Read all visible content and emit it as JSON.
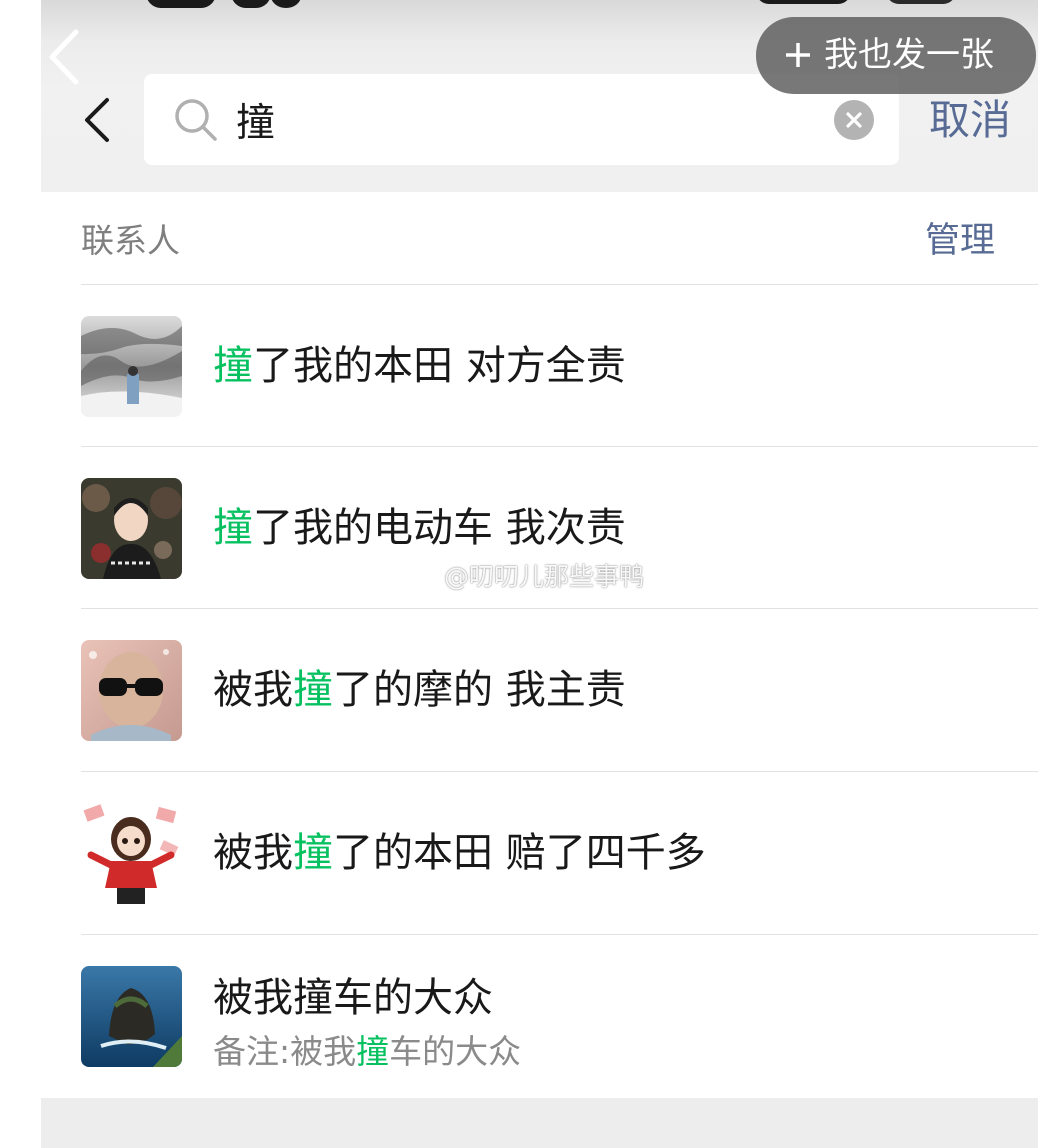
{
  "header": {
    "search_query": "撞",
    "cancel_label": "取消",
    "post_button_label": "我也发一张"
  },
  "section": {
    "title": "联系人",
    "manage_label": "管理"
  },
  "contacts": [
    {
      "pre": "",
      "hl": "撞",
      "post": "了我的本田 对方全责"
    },
    {
      "pre": "",
      "hl": "撞",
      "post": "了我的电动车 我次责"
    },
    {
      "pre": "被我",
      "hl": "撞",
      "post": "了的摩的 我主责"
    },
    {
      "pre": "被我",
      "hl": "撞",
      "post": "了的本田 赔了四千多"
    },
    {
      "name": "被我撞车的大众",
      "remark_pre": "备注:被我",
      "remark_hl": "撞",
      "remark_post": "车的大众"
    }
  ],
  "watermark": "@叨叨儿那些事鸭",
  "colors": {
    "highlight": "#07c160",
    "link": "#576b95"
  }
}
